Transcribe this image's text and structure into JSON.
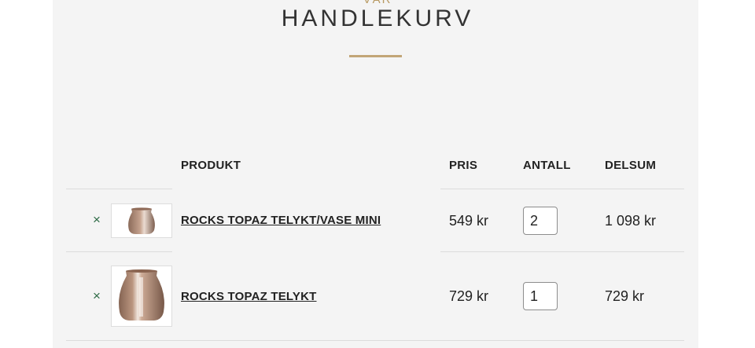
{
  "header": {
    "eyebrow": "VÅR",
    "title": "HANDLEKURV"
  },
  "cart": {
    "columns": {
      "product": "PRODUKT",
      "price": "PRIS",
      "quantity": "ANTALL",
      "subtotal": "DELSUM"
    },
    "items": [
      {
        "remove_symbol": "×",
        "thumbnail_icon": "vase-mini-icon",
        "name": "ROCKS TOPAZ TELYKT/VASE MINI",
        "price": "549 kr",
        "quantity": "2",
        "subtotal": "1 098 kr"
      },
      {
        "remove_symbol": "×",
        "thumbnail_icon": "candle-holder-icon",
        "name": "ROCKS TOPAZ TELYKT",
        "price": "729 kr",
        "quantity": "1",
        "subtotal": "729 kr"
      }
    ]
  },
  "colors": {
    "accent": "#c2a577",
    "remove": "#2e6b46",
    "product_tint": "#a57c62"
  }
}
